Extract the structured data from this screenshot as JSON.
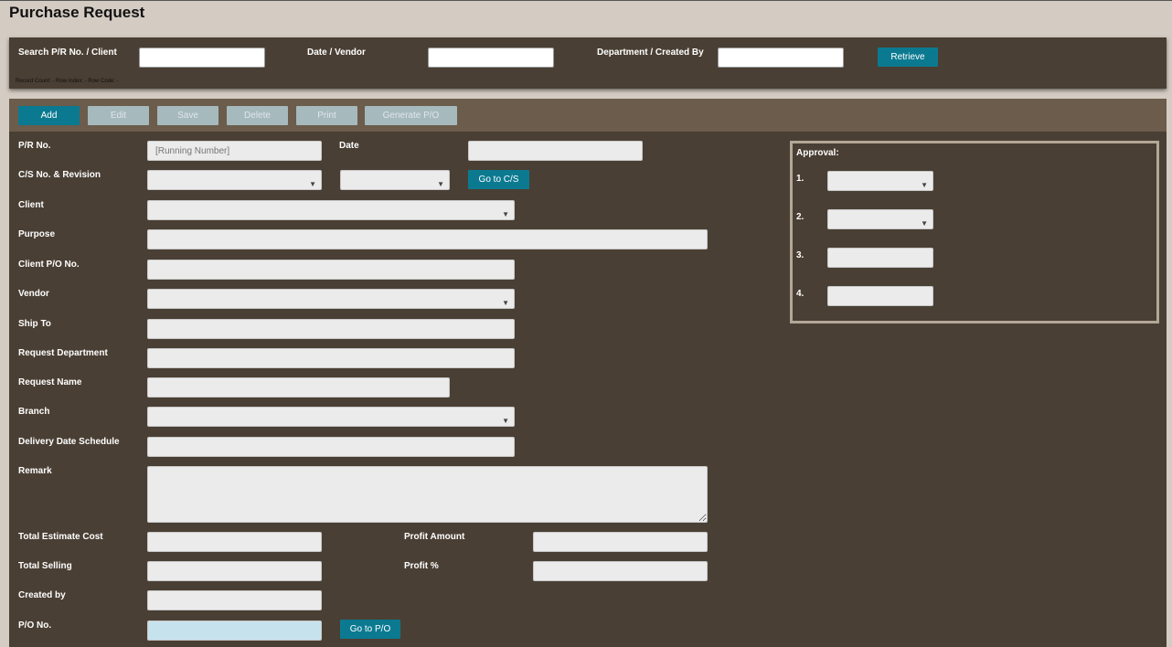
{
  "page": {
    "title": "Purchase Request"
  },
  "search": {
    "label_pr": "Search P/R No. / Client",
    "label_date": "Date / Vendor",
    "label_dept": "Department / Created By",
    "retrieve": "Retrieve",
    "status": "Record Count: - Row Index: - Row Code: -"
  },
  "toolbar": {
    "add": "Add",
    "edit": "Edit",
    "save": "Save",
    "delete": "Delete",
    "print": "Print",
    "generate_po": "Generate P/O"
  },
  "form": {
    "pr_no": "P/R No.",
    "pr_no_placeholder": "[Running Number]",
    "date": "Date",
    "cs_no": "C/S No. & Revision",
    "go_cs": "Go to C/S",
    "client": "Client",
    "purpose": "Purpose",
    "client_po": "Client P/O No.",
    "vendor": "Vendor",
    "ship_to": "Ship To",
    "request_dept": "Request Department",
    "request_name": "Request Name",
    "branch": "Branch",
    "delivery": "Delivery Date Schedule",
    "remark": "Remark",
    "total_est": "Total Estimate Cost",
    "profit_amount": "Profit Amount",
    "total_selling": "Total Selling",
    "profit_pct": "Profit %",
    "created_by": "Created by",
    "po_no": "P/O No.",
    "go_po": "Go to P/O"
  },
  "approval": {
    "title": "Approval:",
    "n1": "1.",
    "n2": "2.",
    "n3": "3.",
    "n4": "4."
  }
}
